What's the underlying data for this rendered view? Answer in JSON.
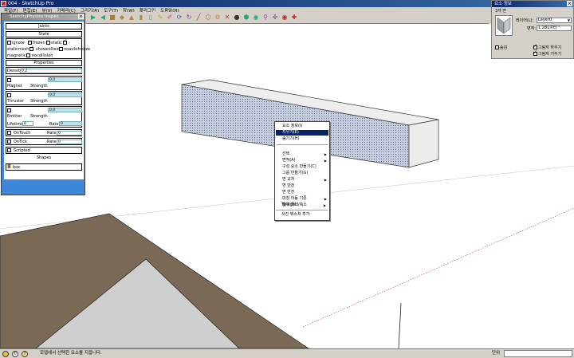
{
  "window": {
    "title": "004 - SketchUp Pro"
  },
  "menu": [
    "파일(F)",
    "편집(E)",
    "뷰(V)",
    "카메라(C)",
    "그리기(R)",
    "도구(T)",
    "창(W)",
    "플러그인",
    "도움말(H)"
  ],
  "toolbar": {
    "icons": [
      "play-icon",
      "rewind-icon",
      "box-icon",
      "iso-view-icon",
      "top-view-icon",
      "front-view-icon",
      "right-view-icon",
      "select-icon",
      "eraser-icon",
      "paint-icon",
      "orbit-icon",
      "line-icon",
      "polygon-icon",
      "circle-icon",
      "arc-icon",
      "push-pull-icon",
      "sphere-icon",
      "component-icon",
      "offset-icon",
      "tape-icon",
      "record-icon",
      "joint-icon"
    ]
  },
  "physics_panel": {
    "title": "SketchyPhysics Inspec",
    "joints_label": "Joints",
    "state_label": "State",
    "state_options": [
      {
        "label": "ignore",
        "checked": false
      },
      {
        "label": "frozen",
        "checked": false
      },
      {
        "label": "static",
        "checked": true
      },
      {
        "label": "staticmesh",
        "checked": true
      },
      {
        "label": "showcollision",
        "checked": false
      },
      {
        "label": "noautofreeze",
        "checked": false
      },
      {
        "label": "magnetic",
        "checked": false
      },
      {
        "label": "nocollision",
        "checked": false
      }
    ],
    "properties_label": "Properties",
    "density_label": "Density",
    "density_value": "0.2",
    "magnet_label": "Magnet",
    "magnet_strength_label": "Strength",
    "magnet_strength_value": "0.0",
    "thruster_label": "Thruster",
    "thruster_strength_label": "Strength",
    "thruster_strength_value": "0.0",
    "emitter_label": "Emitter",
    "emitter_strength_label": "Strength",
    "emitter_strength_value": "0.0",
    "lifetime_label": "Lifetime",
    "lifetime_value": "0",
    "rate_label": "Rate",
    "rate_value": "0",
    "ontouch_label": "OnTouch",
    "ontouch_rate_label": "Rate",
    "ontouch_rate_value": "0",
    "ontick_label": "OnTick",
    "ontick_rate_label": "Rate",
    "ontick_rate_value": "0",
    "scripted_label": "Scripted",
    "shapes_label": "Shapes",
    "shape_value": "box"
  },
  "entity_panel": {
    "title": "요소 정보",
    "subtitle": "3개 면",
    "layer_label": "레이어(L):",
    "layer_value": "Layer0",
    "area_label": "면적:",
    "area_value": "1.281미터 ²",
    "hidden_label": "숨김",
    "cast_shadow_label": "그림자 하우기",
    "receive_shadow_label": "그림자 거두기"
  },
  "context_menu": {
    "items": [
      {
        "label": "요소 정보(I)",
        "submenu": false
      },
      {
        "label": "지우기(E)",
        "submenu": false,
        "selected": true
      },
      {
        "label": "숨기기(H)",
        "submenu": false
      },
      {
        "label": "선택",
        "submenu": true,
        "sep_before": true
      },
      {
        "label": "면적(A)",
        "submenu": true
      },
      {
        "label": "구성 요소 만들기(C)",
        "submenu": false
      },
      {
        "label": "그룹 만들기(G)",
        "submenu": false
      },
      {
        "label": "면 교차",
        "submenu": true
      },
      {
        "label": "면 반전",
        "submenu": false
      },
      {
        "label": "면 반전",
        "submenu": false
      },
      {
        "label": "대칭 이동 기준",
        "submenu": true
      },
      {
        "label": "범위 확대/축소",
        "submenu": false
      },
      {
        "label": "Twilight",
        "submenu": true,
        "sep_before": true
      },
      {
        "label": "사진 텍스처 추가",
        "submenu": false,
        "sep_before": true
      }
    ]
  },
  "status": {
    "message": "모델에서 선택한 요소를 지웁니다.",
    "unit_label": "단위"
  }
}
